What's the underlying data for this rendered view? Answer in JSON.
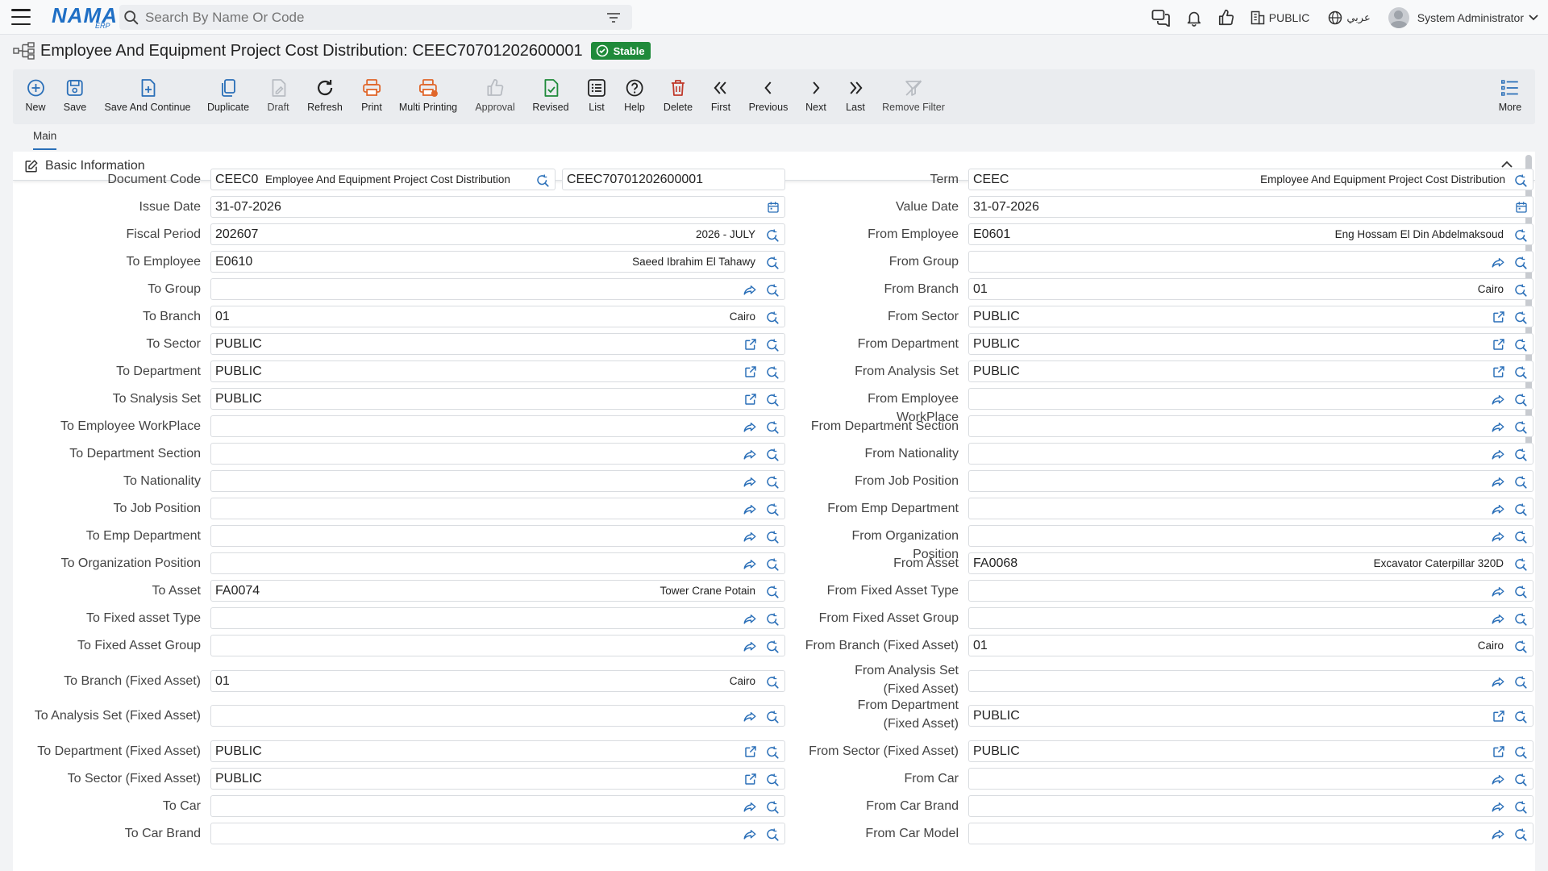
{
  "app": {
    "logo_main": "NAMA",
    "logo_sub": "ERP"
  },
  "search": {
    "placeholder": "Search By Name Or Code"
  },
  "top_right": {
    "sector": "PUBLIC",
    "language": "عربي",
    "user": "System Administrator"
  },
  "page": {
    "title": "Employee And Equipment Project Cost Distribution: CEEC70701202600001",
    "status": "Stable"
  },
  "toolbar": [
    {
      "label": "New",
      "icon": "plus-circle-icon"
    },
    {
      "label": "Save",
      "icon": "save-icon"
    },
    {
      "label": "Save And Continue",
      "icon": "save-continue-icon"
    },
    {
      "label": "Duplicate",
      "icon": "duplicate-icon"
    },
    {
      "label": "Draft",
      "icon": "draft-icon"
    },
    {
      "label": "Refresh",
      "icon": "refresh-icon"
    },
    {
      "label": "Print",
      "icon": "print-icon"
    },
    {
      "label": "Multi Printing",
      "icon": "multi-print-icon"
    },
    {
      "label": "Approval",
      "icon": "thumbs-up-icon"
    },
    {
      "label": "Revised",
      "icon": "revised-icon"
    },
    {
      "label": "List",
      "icon": "list-icon"
    },
    {
      "label": "Help",
      "icon": "help-icon"
    },
    {
      "label": "Delete",
      "icon": "trash-icon"
    },
    {
      "label": "First",
      "icon": "double-chevron-left-icon"
    },
    {
      "label": "Previous",
      "icon": "chevron-left-icon"
    },
    {
      "label": "Next",
      "icon": "chevron-right-icon"
    },
    {
      "label": "Last",
      "icon": "double-chevron-right-icon"
    },
    {
      "label": "Remove Filter",
      "icon": "remove-filter-icon"
    },
    {
      "label": "More",
      "icon": "more-list-icon"
    }
  ],
  "tabs": [
    {
      "label": "Main"
    }
  ],
  "section": {
    "title": "Basic Information"
  },
  "colors": {
    "accent": "#2a6fb8",
    "stable": "#1f8a3a",
    "danger": "#c0392b",
    "print": "#e0662a"
  },
  "fields": {
    "doc_code": {
      "label": "Document Code",
      "code": "CEEC0",
      "desc": "Employee And Equipment Project Cost Distribution",
      "number": "CEEC70701202600001"
    },
    "term": {
      "label": "Term",
      "code": "CEEC",
      "desc": "Employee And Equipment Project Cost Distribution"
    },
    "issue_date": {
      "label": "Issue Date",
      "value": "31-07-2026"
    },
    "value_date": {
      "label": "Value Date",
      "value": "31-07-2026"
    },
    "left": [
      {
        "label": "Fiscal Period",
        "value": "202607",
        "desc": "2026 - JULY",
        "icons": [
          "search"
        ]
      },
      {
        "label": "To Employee",
        "value": "E0610",
        "desc": "Saeed Ibrahim El Tahawy",
        "icons": [
          "search"
        ]
      },
      {
        "label": "To Group",
        "value": "",
        "desc": "",
        "icons": [
          "share",
          "search"
        ]
      },
      {
        "label": "To Branch",
        "value": "01",
        "desc": "Cairo",
        "icons": [
          "search"
        ]
      },
      {
        "label": "To Sector",
        "value": "PUBLIC",
        "desc": "",
        "icons": [
          "external",
          "search"
        ]
      },
      {
        "label": "To Department",
        "value": "PUBLIC",
        "desc": "",
        "icons": [
          "external",
          "search"
        ]
      },
      {
        "label": "To Snalysis Set",
        "value": "PUBLIC",
        "desc": "",
        "icons": [
          "external",
          "search"
        ]
      },
      {
        "label": "To Employee WorkPlace",
        "value": "",
        "desc": "",
        "icons": [
          "share",
          "search"
        ]
      },
      {
        "label": "To Department Section",
        "value": "",
        "desc": "",
        "icons": [
          "share",
          "search"
        ]
      },
      {
        "label": "To Nationality",
        "value": "",
        "desc": "",
        "icons": [
          "share",
          "search"
        ]
      },
      {
        "label": "To Job Position",
        "value": "",
        "desc": "",
        "icons": [
          "share",
          "search"
        ]
      },
      {
        "label": "To Emp Department",
        "value": "",
        "desc": "",
        "icons": [
          "share",
          "search"
        ]
      },
      {
        "label": "To Organization Position",
        "value": "",
        "desc": "",
        "icons": [
          "share",
          "search"
        ]
      },
      {
        "label": "To Asset",
        "value": "FA0074",
        "desc": "Tower Crane Potain",
        "icons": [
          "search"
        ]
      },
      {
        "label": "To Fixed asset Type",
        "value": "",
        "desc": "",
        "icons": [
          "share",
          "search"
        ]
      },
      {
        "label": "To Fixed Asset Group",
        "value": "",
        "desc": "",
        "icons": [
          "share",
          "search"
        ]
      },
      {
        "label": "To Branch (Fixed Asset)",
        "value": "01",
        "desc": "Cairo",
        "icons": [
          "search"
        ]
      },
      {
        "label": "To Analysis Set (Fixed Asset)",
        "value": "",
        "desc": "",
        "icons": [
          "share",
          "search"
        ]
      },
      {
        "label": "To Department (Fixed Asset)",
        "value": "PUBLIC",
        "desc": "",
        "icons": [
          "external",
          "search"
        ]
      },
      {
        "label": "To Sector (Fixed Asset)",
        "value": "PUBLIC",
        "desc": "",
        "icons": [
          "external",
          "search"
        ]
      },
      {
        "label": "To Car",
        "value": "",
        "desc": "",
        "icons": [
          "share",
          "search"
        ]
      },
      {
        "label": "To Car Brand",
        "value": "",
        "desc": "",
        "icons": [
          "share",
          "search"
        ]
      }
    ],
    "right": [
      {
        "label": "From Employee",
        "value": "E0601",
        "desc": "Eng Hossam El Din Abdelmaksoud",
        "icons": [
          "search"
        ]
      },
      {
        "label": "From Group",
        "value": "",
        "desc": "",
        "icons": [
          "share",
          "search"
        ]
      },
      {
        "label": "From Branch",
        "value": "01",
        "desc": "Cairo",
        "icons": [
          "search"
        ]
      },
      {
        "label": "From Sector",
        "value": "PUBLIC",
        "desc": "",
        "icons": [
          "external",
          "search"
        ]
      },
      {
        "label": "From Department",
        "value": "PUBLIC",
        "desc": "",
        "icons": [
          "external",
          "search"
        ]
      },
      {
        "label": "From Analysis Set",
        "value": "PUBLIC",
        "desc": "",
        "icons": [
          "external",
          "search"
        ]
      },
      {
        "label": "From Employee WorkPlace",
        "value": "",
        "desc": "",
        "icons": [
          "share",
          "search"
        ]
      },
      {
        "label": "From Department Section",
        "value": "",
        "desc": "",
        "icons": [
          "share",
          "search"
        ]
      },
      {
        "label": "From Nationality",
        "value": "",
        "desc": "",
        "icons": [
          "share",
          "search"
        ]
      },
      {
        "label": "From Job Position",
        "value": "",
        "desc": "",
        "icons": [
          "share",
          "search"
        ]
      },
      {
        "label": "From Emp Department",
        "value": "",
        "desc": "",
        "icons": [
          "share",
          "search"
        ]
      },
      {
        "label": "From Organization Position",
        "value": "",
        "desc": "",
        "icons": [
          "share",
          "search"
        ]
      },
      {
        "label": "From Asset",
        "value": "FA0068",
        "desc": "Excavator Caterpillar 320D",
        "icons": [
          "search"
        ]
      },
      {
        "label": "From Fixed Asset Type",
        "value": "",
        "desc": "",
        "icons": [
          "share",
          "search"
        ]
      },
      {
        "label": "From Fixed Asset Group",
        "value": "",
        "desc": "",
        "icons": [
          "share",
          "search"
        ]
      },
      {
        "label": "From Branch (Fixed Asset)",
        "value": "01",
        "desc": "Cairo",
        "icons": [
          "search"
        ]
      },
      {
        "label": "From Analysis Set (Fixed Asset)",
        "value": "",
        "desc": "",
        "icons": [
          "share",
          "search"
        ]
      },
      {
        "label": "From Department (Fixed Asset)",
        "value": "PUBLIC",
        "desc": "",
        "icons": [
          "external",
          "search"
        ]
      },
      {
        "label": "From Sector (Fixed Asset)",
        "value": "PUBLIC",
        "desc": "",
        "icons": [
          "external",
          "search"
        ]
      },
      {
        "label": "From Car",
        "value": "",
        "desc": "",
        "icons": [
          "share",
          "search"
        ]
      },
      {
        "label": "From Car Brand",
        "value": "",
        "desc": "",
        "icons": [
          "share",
          "search"
        ]
      },
      {
        "label": "From Car Model",
        "value": "",
        "desc": "",
        "icons": [
          "share",
          "search"
        ]
      }
    ]
  }
}
